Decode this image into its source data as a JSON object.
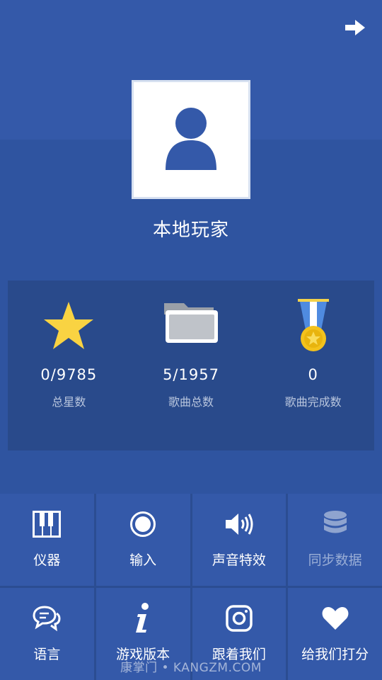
{
  "player": {
    "name": "本地玩家"
  },
  "stats": [
    {
      "value": "0/9785",
      "label": "总星数",
      "icon": "star-icon"
    },
    {
      "value": "5/1957",
      "label": "歌曲总数",
      "icon": "folder-icon"
    },
    {
      "value": "0",
      "label": "歌曲完成数",
      "icon": "medal-icon"
    }
  ],
  "menu": [
    {
      "label": "仪器",
      "icon": "piano-icon"
    },
    {
      "label": "输入",
      "icon": "record-icon"
    },
    {
      "label": "声音特效",
      "icon": "speaker-icon"
    },
    {
      "label": "同步数据",
      "icon": "database-icon",
      "disabled": true
    },
    {
      "label": "语言",
      "icon": "chat-icon"
    },
    {
      "label": "游戏版本",
      "icon": "info-icon"
    },
    {
      "label": "跟着我们",
      "icon": "instagram-icon"
    },
    {
      "label": "给我们打分",
      "icon": "heart-icon"
    }
  ],
  "watermark": "康掌门 • KANGZM.COM",
  "colors": {
    "background": "#3358a5",
    "stats_panel": "#294a8b",
    "tile": "#3459a9",
    "star": "#f9d342"
  }
}
